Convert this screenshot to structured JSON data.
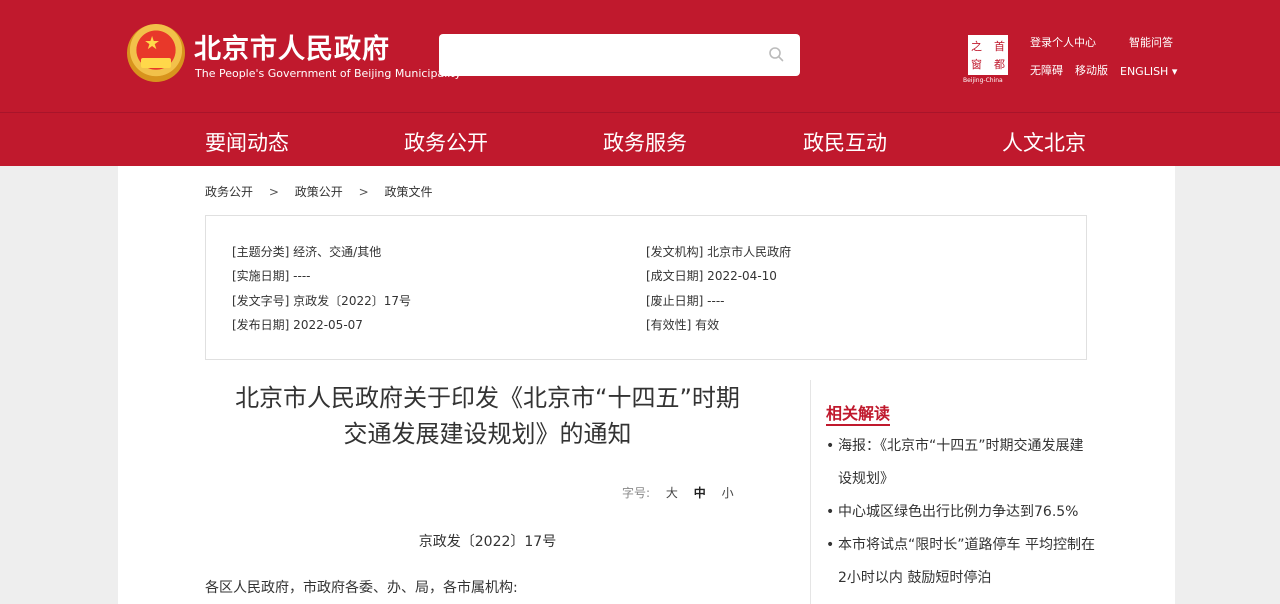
{
  "header": {
    "site_title": "北京市人民政府",
    "site_subtitle": "The People's Government of Beijing Municipality",
    "search_placeholder": "",
    "capital_logo": {
      "c1": "之",
      "c2": "首",
      "c3": "窗",
      "c4": "都",
      "caption": "Beijing-China"
    },
    "links": {
      "login": "登录个人中心",
      "smart_qa": "智能问答",
      "accessibility": "无障碍",
      "mobile": "移动版",
      "english": "ENGLISH ▾"
    }
  },
  "nav": [
    "要闻动态",
    "政务公开",
    "政务服务",
    "政民互动",
    "人文北京"
  ],
  "breadcrumb": [
    "政务公开",
    "政策公开",
    "政策文件"
  ],
  "breadcrumb_sep": ">",
  "meta": {
    "topic": "[主题分类] 经济、交通/其他",
    "effective_date": "[实施日期] ----",
    "doc_no": "[发文字号] 京政发〔2022〕17号",
    "publish_date": "[发布日期] 2022-05-07",
    "issuer": "[发文机构] 北京市人民政府",
    "created_date": "[成文日期] 2022-04-10",
    "expiry_date": "[废止日期] ----",
    "validity": "[有效性] 有效"
  },
  "article": {
    "title_line1": "北京市人民政府关于印发《北京市“十四五”时期",
    "title_line2": "交通发展建设规划》的通知",
    "font_size_label": "字号:",
    "font_large": "大",
    "font_medium": "中",
    "font_small": "小",
    "doc_number": "京政发〔2022〕17号",
    "salutation": "各区人民政府，市政府各委、办、局，各市属机构:"
  },
  "related": {
    "title": "相关解读",
    "items": [
      "海报：《北京市“十四五”时期交通发展建设规划》",
      "中心城区绿色出行比例力争达到76.5%",
      "本市将试点“限时长”道路停车 平均控制在2小时以内 鼓励短时停泊"
    ]
  },
  "colors": {
    "brand_red": "#c0192d"
  }
}
